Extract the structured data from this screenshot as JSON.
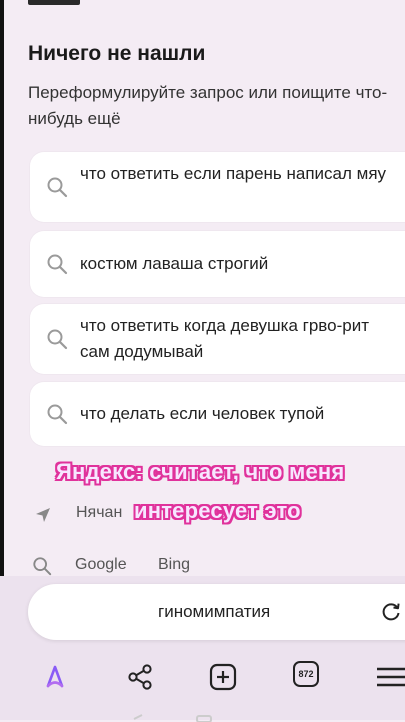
{
  "header": {
    "title": "Ничего не нашли",
    "subtitle": "Переформулируйте запрос или поищите что-нибудь ещё"
  },
  "suggestions": [
    {
      "text": "что ответить если парень написал мяу"
    },
    {
      "text": "костюм лаваша строгий"
    },
    {
      "text": "что ответить когда девушка грво-рит сам додумывай"
    },
    {
      "text": "что делать если человек тупой"
    }
  ],
  "overlay": {
    "line1": "Яндекс: считает, что меня",
    "line2": "интересует это",
    "color": "#e0329b"
  },
  "location": {
    "label": "Нячан"
  },
  "engines": [
    "Google",
    "Bing"
  ],
  "search_bar": {
    "query": "гиномимпатия"
  },
  "navbar": {
    "tabs_count": "872"
  },
  "icons": [
    "alice-icon",
    "share-icon",
    "new-tab-icon",
    "tabs-icon",
    "menu-icon",
    "search-icon",
    "location-arrow-icon",
    "reload-icon"
  ]
}
